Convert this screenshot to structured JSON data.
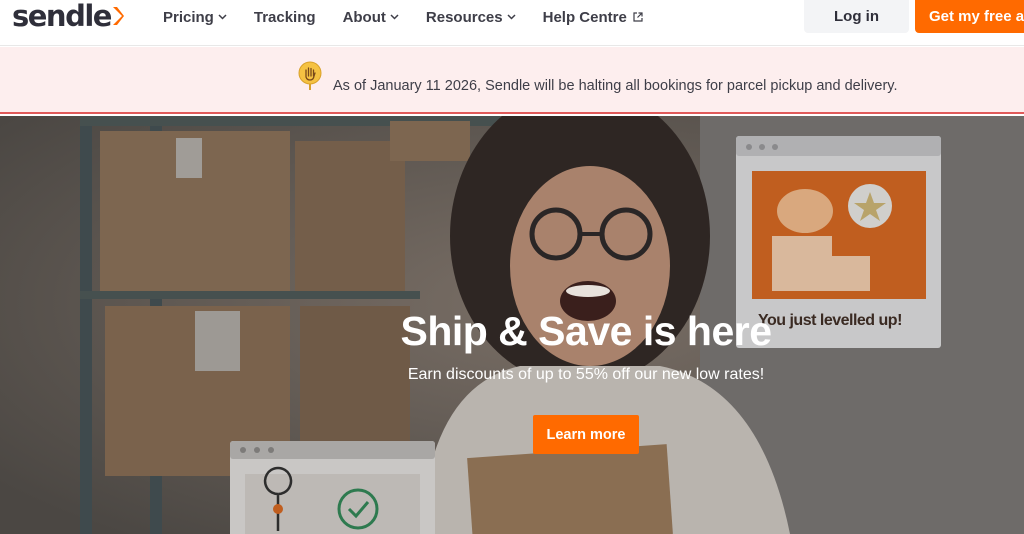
{
  "nav": {
    "logo_text": "sendle",
    "items": [
      {
        "label": "Pricing",
        "icon": "chevron-down-icon"
      },
      {
        "label": "Tracking"
      },
      {
        "label": "About",
        "icon": "chevron-down-icon"
      },
      {
        "label": "Resources",
        "icon": "chevron-down-icon"
      },
      {
        "label": "Help Centre",
        "icon": "external-link-icon"
      }
    ],
    "login_label": "Log in",
    "cta_label": "Get my free ac"
  },
  "banner": {
    "icon": "hand-stop-icon",
    "text": "As of January 11 2026, Sendle will be halting all bookings for parcel pickup and delivery."
  },
  "hero": {
    "title": "Ship & Save is here",
    "subtitle": "Earn discounts of up to 55% off our new low rates!",
    "button_label": "Learn more",
    "card_caption": "You just levelled up!"
  },
  "colors": {
    "brand_orange": "#ff6a00",
    "banner_bg": "#fdeeee",
    "banner_border": "#e05a5a",
    "text_dark": "#2f2f3a"
  }
}
